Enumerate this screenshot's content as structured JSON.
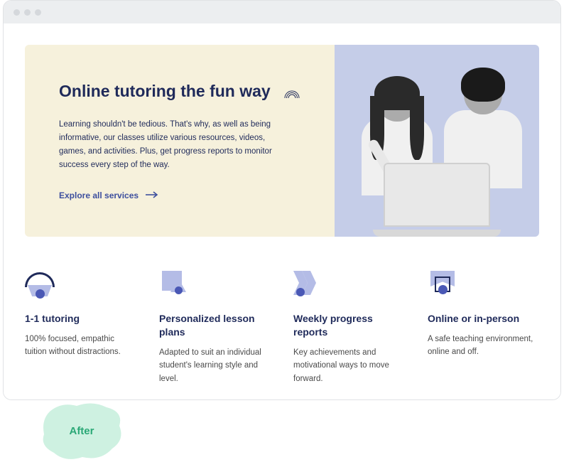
{
  "hero": {
    "title": "Online tutoring the fun way",
    "description": "Learning shouldn't be tedious. That's why, as well as being informative, our classes utilize various resources, videos, games, and activities. Plus, get progress reports to monitor success every step of the way.",
    "cta_label": "Explore all services",
    "decoration_icon": "rainbow-icon",
    "image_alt": "Two students collaborating at a laptop"
  },
  "features": [
    {
      "icon": "arc-shape-icon",
      "title": "1-1 tutoring",
      "description": "100% focused, empathic tuition without distractions."
    },
    {
      "icon": "square-triangle-icon",
      "title": "Personalized lesson plans",
      "description": "Adapted to suit an individual student's learning style and level."
    },
    {
      "icon": "chevron-icon",
      "title": "Weekly progress reports",
      "description": "Key achievements and motivational ways to move forward."
    },
    {
      "icon": "envelope-icon",
      "title": "Online or in-person",
      "description": "A safe teaching environment, online and off."
    }
  ],
  "badge": {
    "label": "After"
  },
  "colors": {
    "brand_navy": "#1f2a5a",
    "brand_indigo": "#3d4f9e",
    "hero_cream": "#f6f1dc",
    "hero_blue": "#c5cde8",
    "accent_periwinkle": "#b4bce6",
    "badge_green": "#2aa876",
    "badge_bg": "#cef1e1"
  }
}
